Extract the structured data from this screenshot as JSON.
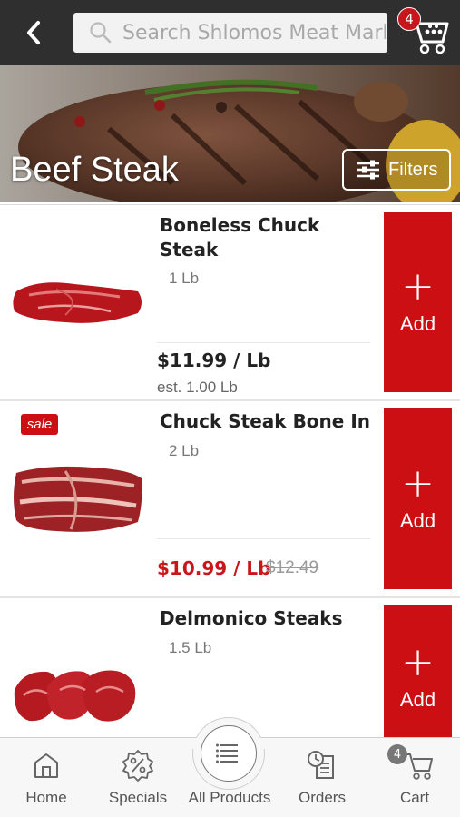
{
  "header": {
    "search_placeholder": "Search Shlomos Meat Market",
    "cart_count": "4"
  },
  "hero": {
    "title": "Beef Steak",
    "filters_label": "Filters"
  },
  "products": [
    {
      "name": "Boneless Chuck Steak",
      "quantity": "1 Lb",
      "price": "$11.99 / Lb",
      "estimate": "est. 1.00 Lb",
      "add_label": "Add",
      "add_icon": "plus-icon"
    },
    {
      "sale_badge": "sale",
      "name": "Chuck Steak Bone In",
      "quantity": "2 Lb",
      "price": "$10.99 / Lb",
      "old_price": "$12.49",
      "add_label": "Add",
      "add_icon": "plus-icon"
    },
    {
      "name": "Delmonico Steaks",
      "quantity": "1.5 Lb",
      "add_label": "Add",
      "add_icon": "plus-icon"
    }
  ],
  "bottom_nav": {
    "items": [
      {
        "label": "Home",
        "icon": "home-icon"
      },
      {
        "label": "Specials",
        "icon": "percent-badge-icon"
      },
      {
        "label": "All Products",
        "icon": "list-icon"
      },
      {
        "label": "Orders",
        "icon": "orders-icon"
      },
      {
        "label": "Cart",
        "icon": "cart-icon"
      }
    ],
    "cart_count": "4"
  },
  "colors": {
    "accent": "#cc0f12",
    "topbar": "#2f2f2f"
  }
}
